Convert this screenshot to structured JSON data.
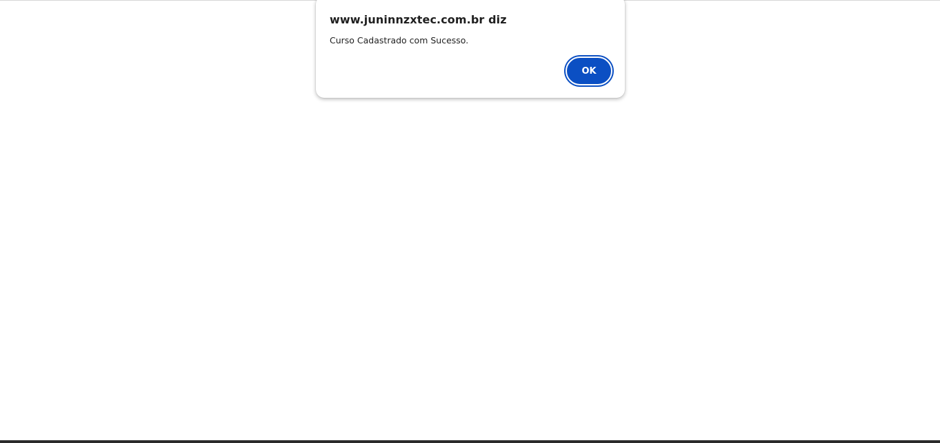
{
  "dialog": {
    "title": "www.juninnzxtec.com.br diz",
    "message": "Curso Cadastrado com Sucesso.",
    "ok_label": "OK"
  },
  "colors": {
    "accent": "#0b4fc3",
    "background": "#ffffff"
  }
}
